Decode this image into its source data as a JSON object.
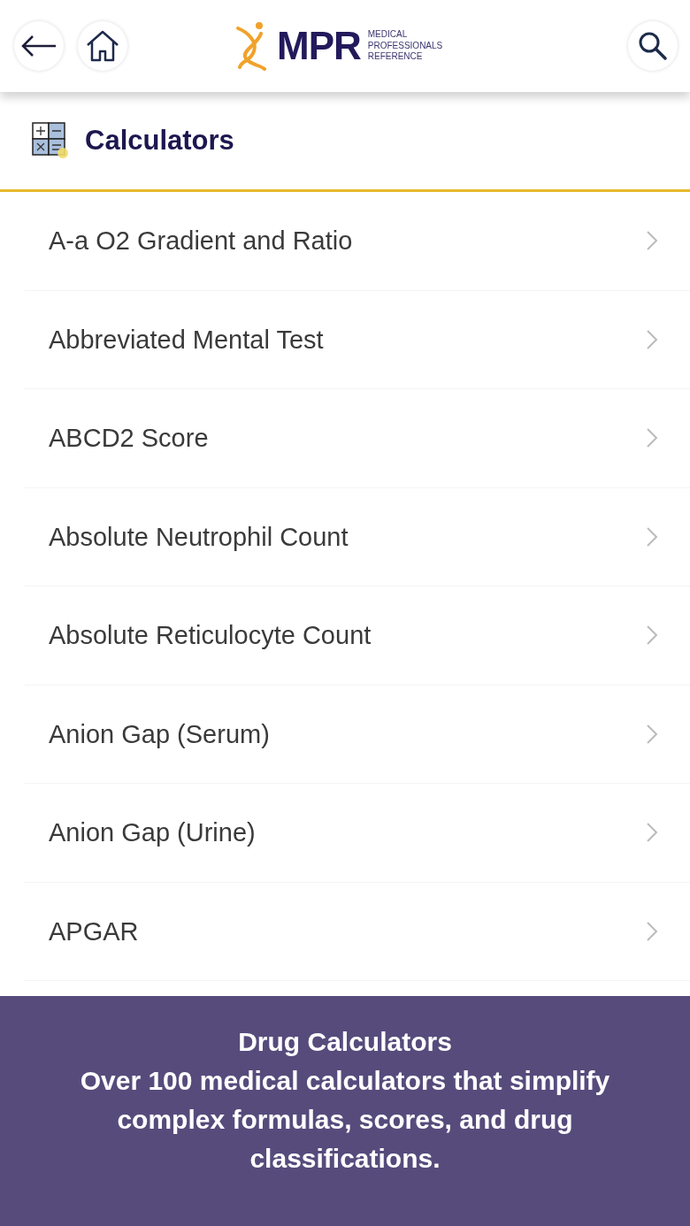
{
  "header": {
    "logo": {
      "wordmark": "MPR",
      "tagline": [
        "MEDICAL",
        "PROFESSIONALS",
        "REFERENCE"
      ]
    }
  },
  "page_title": "Calculators",
  "calculators": [
    {
      "label": "A-a O2 Gradient and Ratio"
    },
    {
      "label": "Abbreviated Mental Test"
    },
    {
      "label": "ABCD2 Score"
    },
    {
      "label": "Absolute Neutrophil Count"
    },
    {
      "label": "Absolute Reticulocyte Count"
    },
    {
      "label": "Anion Gap (Serum)"
    },
    {
      "label": "Anion Gap (Urine)"
    },
    {
      "label": "APGAR"
    }
  ],
  "caption": {
    "title": "Drug Calculators",
    "text": "Over 100 medical calculators that simplify complex formulas, scores, and drug classifications."
  }
}
